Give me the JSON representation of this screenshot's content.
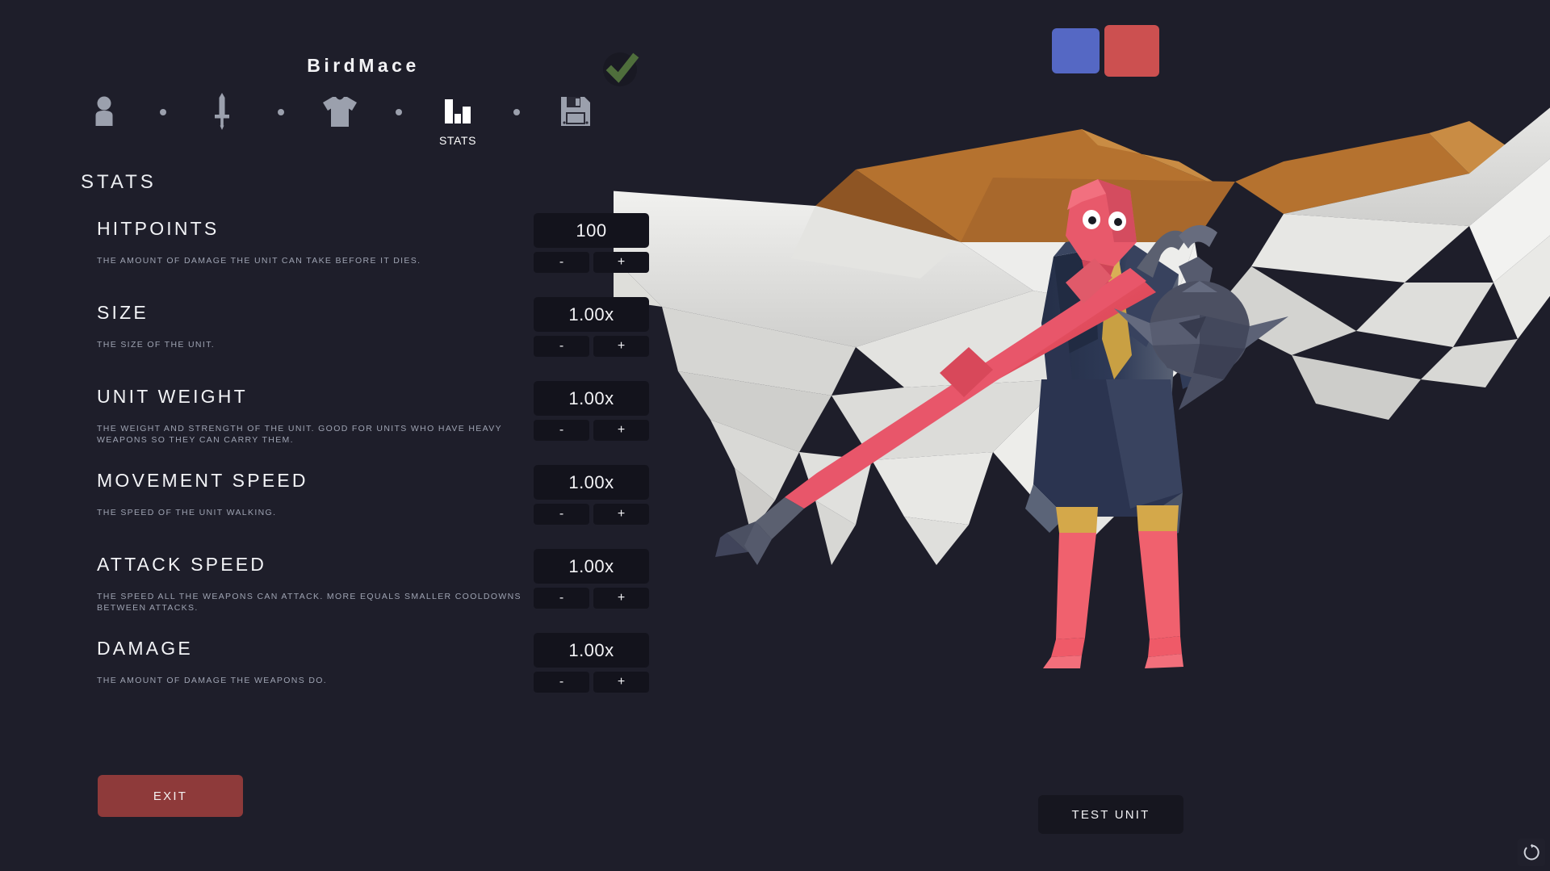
{
  "app": {
    "background_color": "#1e1e2a",
    "unit_title": "BirdMace"
  },
  "team_colors": {
    "blue": {
      "name": "blue-team-swatch",
      "hex": "#5568c4",
      "selected": false
    },
    "red": {
      "name": "red-team-swatch",
      "hex": "#cc5050",
      "selected": true
    }
  },
  "confirm": {
    "name": "confirm-checkmark",
    "check_color": "#4f6e3c",
    "circle_color": "#191923"
  },
  "nav": {
    "items": [
      {
        "icon": "person-icon",
        "label": "",
        "active": false
      },
      {
        "icon": "sword-icon",
        "label": "",
        "active": false
      },
      {
        "icon": "shirt-icon",
        "label": "",
        "active": false
      },
      {
        "icon": "bar-chart-icon",
        "label": "STATS",
        "active": true
      },
      {
        "icon": "save-icon",
        "label": "",
        "active": false
      }
    ],
    "inactive_color": "#9ba0ad",
    "active_color": "#ffffff"
  },
  "panel": {
    "heading": "STATS",
    "stats": [
      {
        "name": "HITPOINTS",
        "description": "THE AMOUNT OF DAMAGE THE UNIT CAN TAKE BEFORE IT DIES.",
        "value": "100",
        "decrement": "-",
        "increment": "+"
      },
      {
        "name": "SIZE",
        "description": "THE SIZE OF THE UNIT.",
        "value": "1.00x",
        "decrement": "-",
        "increment": "+"
      },
      {
        "name": "UNIT WEIGHT",
        "description": "THE WEIGHT AND STRENGTH OF THE UNIT. GOOD FOR UNITS WHO HAVE HEAVY WEAPONS SO THEY CAN CARRY THEM.",
        "value": "1.00x",
        "decrement": "-",
        "increment": "+"
      },
      {
        "name": "MOVEMENT SPEED",
        "description": "THE SPEED OF THE UNIT WALKING.",
        "value": "1.00x",
        "decrement": "-",
        "increment": "+"
      },
      {
        "name": "ATTACK SPEED",
        "description": "THE SPEED ALL THE WEAPONS CAN ATTACK. MORE EQUALS SMALLER COOLDOWNS BETWEEN ATTACKS.",
        "value": "1.00x",
        "decrement": "-",
        "increment": "+"
      },
      {
        "name": "DAMAGE",
        "description": "THE AMOUNT OF DAMAGE THE WEAPONS DO.",
        "value": "1.00x",
        "decrement": "-",
        "increment": "+"
      }
    ]
  },
  "footer": {
    "exit_label": "EXIT",
    "exit_color": "#8e3a3a",
    "test_unit_label": "TEST UNIT",
    "test_unit_color": "#16161f"
  },
  "status": {
    "spinner_icon": "loading-spinner-icon"
  },
  "character": {
    "name": "BirdMace unit preview",
    "head_color": "#e8596b",
    "wing_color": "#e8e8e6",
    "wing_edge_color": "#b5722f",
    "suit_color": "#2a3550",
    "tie_color": "#c9a043",
    "leg_color": "#f0616e",
    "cuff_color": "#d4a84a",
    "mace_pole_color": "#e0515f",
    "mace_head_color": "#4c5062"
  }
}
